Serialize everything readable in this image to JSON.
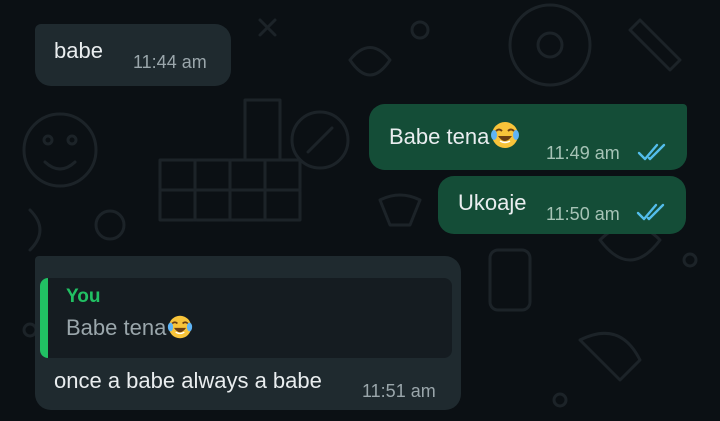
{
  "chat": {
    "background_color": "#0b1014",
    "incoming_bubble_color": "#1f2a2f",
    "outgoing_bubble_color": "#144d37",
    "read_tick_color": "#53bdeb",
    "messages": [
      {
        "direction": "incoming",
        "text": "babe",
        "time": "11:44 am"
      },
      {
        "direction": "outgoing",
        "text": "Babe tena",
        "emoji": "face-with-tears-of-joy",
        "time": "11:49 am",
        "status": "read"
      },
      {
        "direction": "outgoing",
        "text": "Ukoaje",
        "time": "11:50 am",
        "status": "read"
      },
      {
        "direction": "incoming",
        "reply_to": {
          "author": "You",
          "text": "Babe tena",
          "emoji": "face-with-tears-of-joy"
        },
        "text": "once a babe always a babe",
        "time": "11:51 am"
      }
    ]
  }
}
